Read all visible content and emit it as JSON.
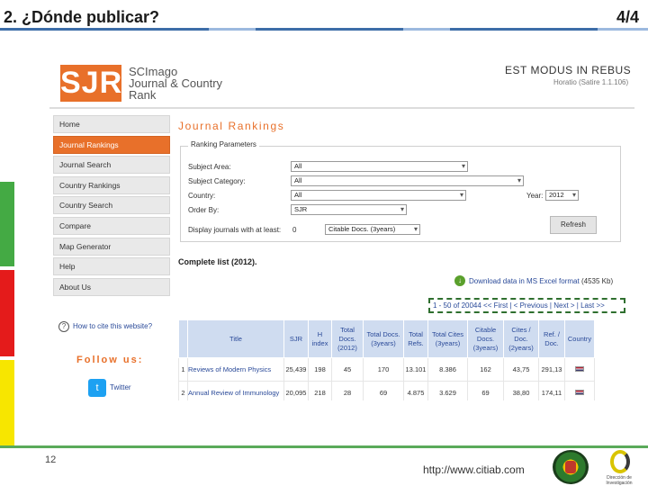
{
  "slide": {
    "title": "2. ¿Dónde publicar?",
    "page": "4/4",
    "number": "12",
    "footer_url": "http://www.citiab.com",
    "logo_text": "Dirección de Investigación"
  },
  "site": {
    "logo": "SJR",
    "name_lines": [
      "SCImago",
      "Journal & Country",
      "Rank"
    ],
    "motto": "EST MODUS IN REBUS",
    "motto_sub": "Horatio (Satire 1.1.106)"
  },
  "nav": [
    "Home",
    "Journal Rankings",
    "Journal Search",
    "Country Rankings",
    "Country Search",
    "Compare",
    "Map Generator",
    "Help",
    "About Us"
  ],
  "sidebar_extra": {
    "cite": "How to cite this website?",
    "follow": "Follow us:",
    "twitter": "Twitter"
  },
  "rankings": {
    "title": "Journal Rankings",
    "params_legend": "Ranking Parameters",
    "subject_area_label": "Subject Area:",
    "subject_area_value": "All",
    "subject_category_label": "Subject Category:",
    "subject_category_value": "All",
    "country_label": "Country:",
    "country_value": "All",
    "year_label": "Year:",
    "year_value": "2012",
    "order_label": "Order By:",
    "order_value": "SJR",
    "display_label": "Display journals with at least:",
    "display_value": "0",
    "display_select": "Citable Docs. (3years)",
    "refresh": "Refresh",
    "complete_list": "Complete list (2012).",
    "download_link": "Download data in MS Excel format",
    "download_size": "(4535 Kb)",
    "pager": "1 - 50 of 20044 << First | < Previous | Next > | Last >>"
  },
  "table": {
    "headers": [
      "",
      "Title",
      "SJR",
      "H index",
      "Total Docs. (2012)",
      "Total Docs. (3years)",
      "Total Refs.",
      "Total Cites (3years)",
      "Citable Docs. (3years)",
      "Cites / Doc. (2years)",
      "Ref. / Doc.",
      "Country"
    ],
    "rows": [
      [
        "1",
        "Reviews of Modern Physics",
        "25,439",
        "198",
        "45",
        "170",
        "13.101",
        "8.386",
        "162",
        "43,75",
        "291,13"
      ],
      [
        "2",
        "Annual Review of Immunology",
        "20,095",
        "218",
        "28",
        "69",
        "4.875",
        "3.629",
        "69",
        "38,80",
        "174,11"
      ]
    ]
  }
}
